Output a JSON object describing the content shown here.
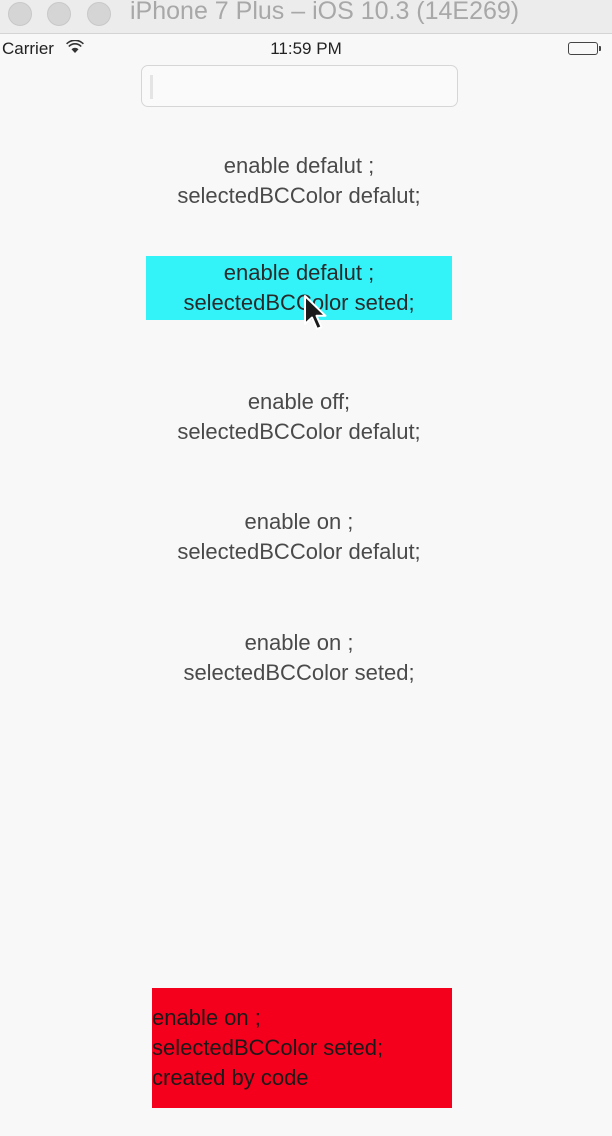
{
  "window": {
    "title": "iPhone 7 Plus – iOS 10.3 (14E269)"
  },
  "status_bar": {
    "carrier": "Carrier",
    "time": "11:59 PM"
  },
  "text_field": {
    "value": "",
    "placeholder": ""
  },
  "buttons": [
    {
      "line1": "enable defalut ;",
      "line2": "selectedBCColor  defalut;"
    },
    {
      "line1": "enable defalut ;",
      "line2": "selectedBCColor  seted;",
      "background": "#33f3f9"
    },
    {
      "line1": "enable off;",
      "line2": "selectedBCColor  defalut;"
    },
    {
      "line1": "enable on ;",
      "line2": "selectedBCColor  defalut;"
    },
    {
      "line1": "enable on ;",
      "line2": "selectedBCColor  seted;"
    },
    {
      "line1": "enable on ;",
      "line2": "selectedBCColor  seted;",
      "line3": "created by code",
      "background": "#f4001c"
    }
  ],
  "icons": {
    "wifi": "wifi-icon",
    "battery": "battery-icon",
    "pointer": "mouse-pointer-icon"
  }
}
